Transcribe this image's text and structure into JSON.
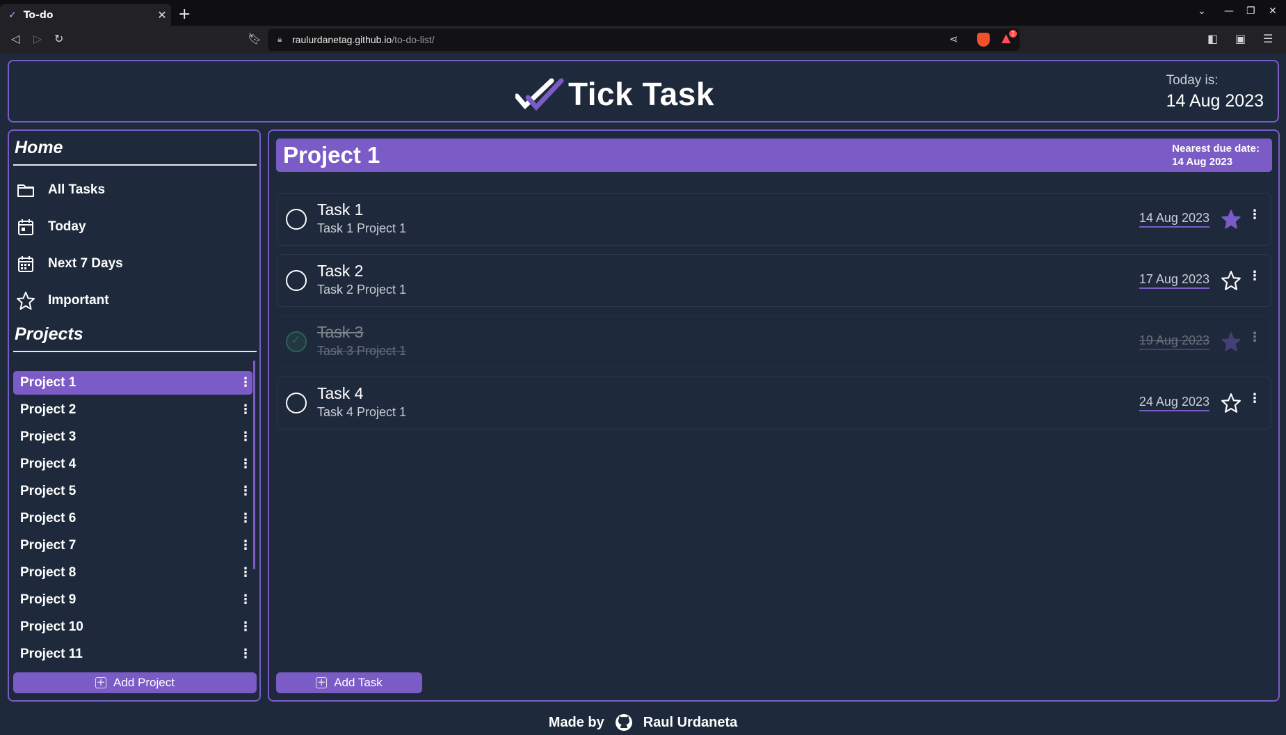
{
  "browser": {
    "tab_title": "To-do",
    "url_host": "raulurdanetag.github.io",
    "url_path": "/to-do-list/",
    "notification_badge": "1"
  },
  "header": {
    "brand": "Tick Task",
    "today_label": "Today is:",
    "today_date": "14 Aug 2023"
  },
  "sidebar": {
    "home_title": "Home",
    "nav": [
      {
        "label": "All Tasks",
        "icon": "folder-icon"
      },
      {
        "label": "Today",
        "icon": "calendar-day-icon"
      },
      {
        "label": "Next 7 Days",
        "icon": "calendar-week-icon"
      },
      {
        "label": "Important",
        "icon": "star-icon"
      }
    ],
    "projects_title": "Projects",
    "projects": [
      {
        "label": "Project 1",
        "active": true
      },
      {
        "label": "Project 2"
      },
      {
        "label": "Project 3"
      },
      {
        "label": "Project 4"
      },
      {
        "label": "Project 5"
      },
      {
        "label": "Project 6"
      },
      {
        "label": "Project 7"
      },
      {
        "label": "Project 8"
      },
      {
        "label": "Project 9"
      },
      {
        "label": "Project 10"
      },
      {
        "label": "Project 11"
      }
    ],
    "add_label": "Add Project"
  },
  "main": {
    "project_name": "Project 1",
    "due_label": "Nearest due date:",
    "due_date": "14 Aug 2023",
    "tasks": [
      {
        "name": "Task 1",
        "desc": "Task 1 Project 1",
        "date": "14 Aug 2023",
        "important": true,
        "done": false
      },
      {
        "name": "Task 2",
        "desc": "Task 2 Project 1",
        "date": "17 Aug 2023",
        "important": false,
        "done": false
      },
      {
        "name": "Task 3",
        "desc": "Task 3 Project 1",
        "date": "19 Aug 2023",
        "important": true,
        "done": true
      },
      {
        "name": "Task 4",
        "desc": "Task 4 Project 1",
        "date": "24 Aug 2023",
        "important": false,
        "done": false
      }
    ],
    "add_label": "Add Task"
  },
  "footer": {
    "made_by": "Made by",
    "author": "Raul Urdaneta"
  },
  "colors": {
    "accent": "#7b5cc7",
    "background": "#1e2a3b",
    "done_green": "#3fb07c"
  }
}
